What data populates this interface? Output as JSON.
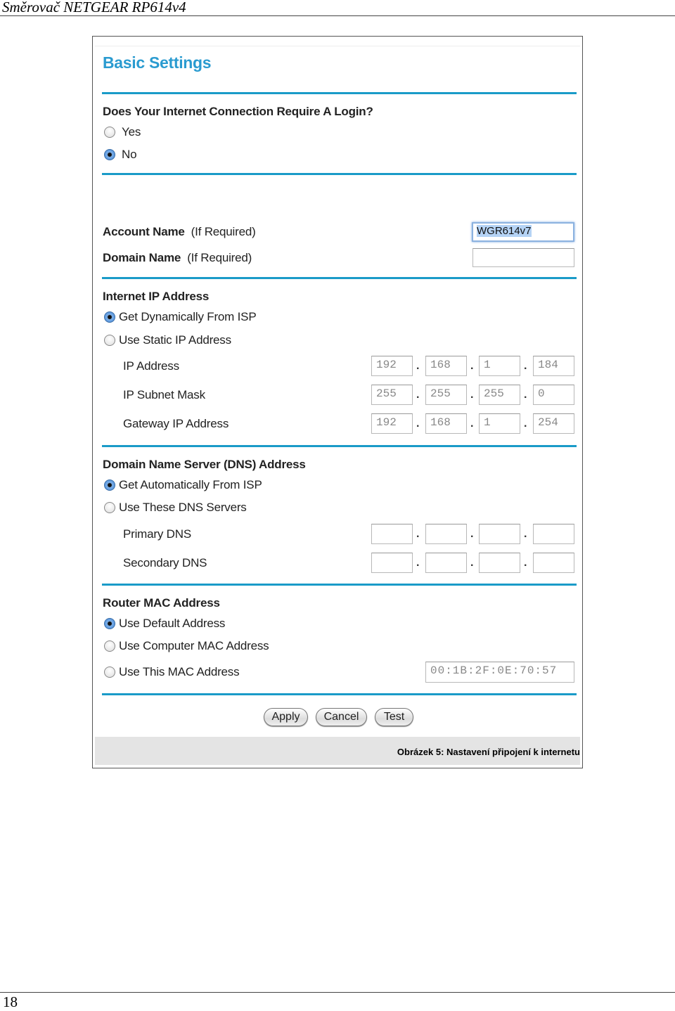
{
  "document": {
    "header": "Směrovač NETGEAR RP614v4",
    "page_number": "18",
    "caption": "Obrázek 5: Nastavení připojení k internetu"
  },
  "screen": {
    "title": "Basic Settings",
    "login": {
      "question": "Does Your Internet Connection Require A Login?",
      "yes": "Yes",
      "no": "No",
      "selected": "No"
    },
    "account": {
      "account_label": "Account Name",
      "account_hint": "(If Required)",
      "account_value": "WGR614v7",
      "domain_label": "Domain Name",
      "domain_hint": "(If Required)",
      "domain_value": ""
    },
    "internet_ip": {
      "heading": "Internet IP Address",
      "dynamic": "Get Dynamically From ISP",
      "static": "Use Static IP Address",
      "selected": "Get Dynamically From ISP",
      "ip_label": "IP Address",
      "ip": [
        "192",
        "168",
        "1",
        "184"
      ],
      "mask_label": "IP Subnet Mask",
      "mask": [
        "255",
        "255",
        "255",
        "0"
      ],
      "gateway_label": "Gateway IP Address",
      "gateway": [
        "192",
        "168",
        "1",
        "254"
      ]
    },
    "dns": {
      "heading": "Domain Name Server (DNS) Address",
      "auto": "Get Automatically From ISP",
      "manual": "Use These DNS Servers",
      "selected": "Get Automatically From ISP",
      "primary_label": "Primary DNS",
      "primary": [
        "",
        "",
        "",
        ""
      ],
      "secondary_label": "Secondary DNS",
      "secondary": [
        "",
        "",
        "",
        ""
      ]
    },
    "mac": {
      "heading": "Router MAC Address",
      "default": "Use Default Address",
      "computer": "Use Computer MAC Address",
      "this": "Use This MAC Address",
      "selected": "Use Default Address",
      "value": "00:1B:2F:0E:70:57"
    },
    "buttons": {
      "apply": "Apply",
      "cancel": "Cancel",
      "test": "Test"
    },
    "dot": ".",
    "colors": {
      "accent": "#1a9bc8",
      "title": "#2a9bd0"
    }
  }
}
